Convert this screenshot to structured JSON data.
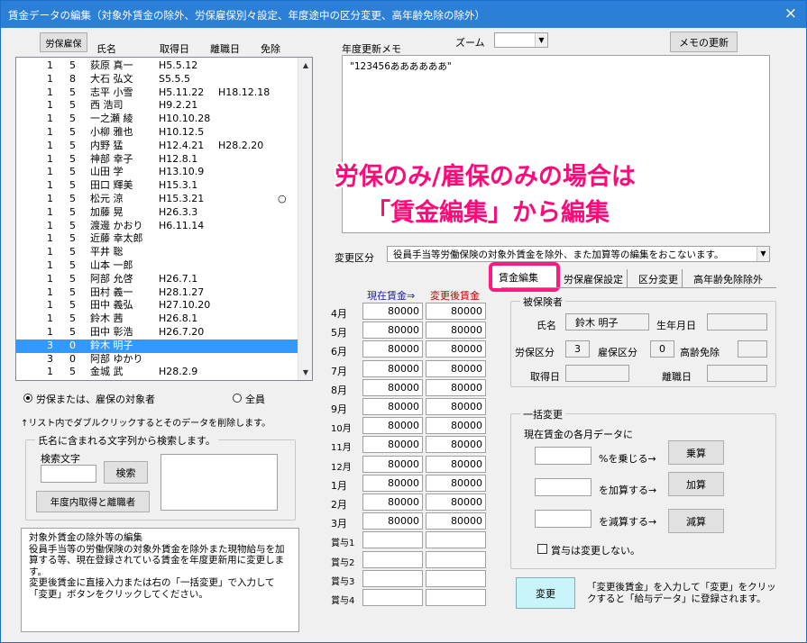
{
  "window": {
    "title": "賃金データの編集（対象外賃金の除外、労保雇保別々設定、年度途中の区分変更、高年齢免除の除外）",
    "close": "×"
  },
  "left": {
    "rousai_button": "労保雇保",
    "headers": {
      "name": "氏名",
      "acquired": "取得日",
      "left": "離職日",
      "exempt": "免除"
    },
    "rows": [
      {
        "a": "1",
        "b": "5",
        "name": "荻原 真一",
        "acq": "H5.5.12",
        "lef": "",
        "ex": ""
      },
      {
        "a": "1",
        "b": "8",
        "name": "大石 弘文",
        "acq": "S5.5.5",
        "lef": "",
        "ex": ""
      },
      {
        "a": "1",
        "b": "5",
        "name": "志平 小雪",
        "acq": "H5.11.22",
        "lef": "H18.12.18",
        "ex": ""
      },
      {
        "a": "1",
        "b": "5",
        "name": "西 浩司",
        "acq": "H9.2.21",
        "lef": "",
        "ex": ""
      },
      {
        "a": "1",
        "b": "5",
        "name": "一之瀬 綾",
        "acq": "H10.10.28",
        "lef": "",
        "ex": ""
      },
      {
        "a": "1",
        "b": "5",
        "name": "小柳 雅也",
        "acq": "H10.12.5",
        "lef": "",
        "ex": ""
      },
      {
        "a": "1",
        "b": "5",
        "name": "内野 猛",
        "acq": "H12.4.21",
        "lef": "H28.2.20",
        "ex": ""
      },
      {
        "a": "1",
        "b": "5",
        "name": "神部 幸子",
        "acq": "H12.8.1",
        "lef": "",
        "ex": ""
      },
      {
        "a": "1",
        "b": "5",
        "name": "山田 学",
        "acq": "H13.10.9",
        "lef": "",
        "ex": ""
      },
      {
        "a": "1",
        "b": "5",
        "name": "田口 輝美",
        "acq": "H15.3.1",
        "lef": "",
        "ex": ""
      },
      {
        "a": "1",
        "b": "5",
        "name": "松元 涼",
        "acq": "H15.3.21",
        "lef": "",
        "ex": "○"
      },
      {
        "a": "1",
        "b": "5",
        "name": "加藤 晃",
        "acq": "H26.3.3",
        "lef": "",
        "ex": ""
      },
      {
        "a": "1",
        "b": "5",
        "name": "渡邊 かおり",
        "acq": "H6.11.14",
        "lef": "",
        "ex": ""
      },
      {
        "a": "1",
        "b": "5",
        "name": "近藤 幸太郎",
        "acq": "",
        "lef": "",
        "ex": ""
      },
      {
        "a": "1",
        "b": "5",
        "name": "平井 聡",
        "acq": "",
        "lef": "",
        "ex": ""
      },
      {
        "a": "1",
        "b": "5",
        "name": "山本 一郎",
        "acq": "",
        "lef": "",
        "ex": ""
      },
      {
        "a": "1",
        "b": "5",
        "name": "阿部 允啓",
        "acq": "H26.7.1",
        "lef": "",
        "ex": ""
      },
      {
        "a": "1",
        "b": "5",
        "name": "田村 義一",
        "acq": "H28.1.27",
        "lef": "",
        "ex": ""
      },
      {
        "a": "1",
        "b": "5",
        "name": "田中 義弘",
        "acq": "H27.10.20",
        "lef": "",
        "ex": ""
      },
      {
        "a": "1",
        "b": "5",
        "name": "鈴木 茜",
        "acq": "H26.8.1",
        "lef": "",
        "ex": ""
      },
      {
        "a": "1",
        "b": "5",
        "name": "田中 彰浩",
        "acq": "H26.7.20",
        "lef": "",
        "ex": ""
      },
      {
        "a": "3",
        "b": "0",
        "name": "鈴木 明子",
        "acq": "",
        "lef": "",
        "ex": ""
      },
      {
        "a": "3",
        "b": "0",
        "name": "阿部 ゆかり",
        "acq": "",
        "lef": "",
        "ex": ""
      },
      {
        "a": "1",
        "b": "5",
        "name": "金城 武",
        "acq": "H28.2.9",
        "lef": "",
        "ex": ""
      }
    ],
    "selected_index": 21,
    "radio_target": "労保または、雇保の対象者",
    "radio_all": "全員",
    "hint": "↑リスト内でダブルクリックするとそのデータを削除します。",
    "search_group": "氏名に含まれる文字列から検索します。",
    "search_label": "検索文字",
    "search_value": "",
    "search_button": "検索",
    "year_button": "年度内取得と離職者",
    "description": "対象外賃金の除外等の編集\n役員手当等の労働保険の対象外賃金を除外また現物給与を加算する等、現在登録されている賃金を年度更新用に変更します。\n変更後賃金に直接入力または右の「一括変更」で入力して「変更」ボタンをクリックしてください。"
  },
  "right": {
    "memo_label": "年度更新メモ",
    "zoom_label": "ズーム",
    "zoom_value": "",
    "memo_update_button": "メモの更新",
    "memo_text": "\"123456ああああああ\"",
    "overlay_line1": "労保のみ/雇保のみの場合は",
    "overlay_line2": "「賃金編集」から編集",
    "change_kind_label": "変更区分",
    "change_kind_value": "役員手当等労働保険の対象外賃金を除外、また加算等の編集をおこないます。",
    "tabs": [
      "賃金編集",
      "労保雇保設定",
      "区分変更",
      "高年齢免除除外"
    ],
    "col_current": "現在賃金⇒",
    "col_changed": "変更後賃金",
    "months": [
      {
        "m": "4月",
        "cur": "80000",
        "chg": "80000"
      },
      {
        "m": "5月",
        "cur": "80000",
        "chg": "80000"
      },
      {
        "m": "6月",
        "cur": "80000",
        "chg": "80000"
      },
      {
        "m": "7月",
        "cur": "80000",
        "chg": "80000"
      },
      {
        "m": "8月",
        "cur": "80000",
        "chg": "80000"
      },
      {
        "m": "9月",
        "cur": "80000",
        "chg": "80000"
      },
      {
        "m": "10月",
        "cur": "80000",
        "chg": "80000"
      },
      {
        "m": "11月",
        "cur": "80000",
        "chg": "80000"
      },
      {
        "m": "12月",
        "cur": "80000",
        "chg": "80000"
      },
      {
        "m": "1月",
        "cur": "80000",
        "chg": "80000"
      },
      {
        "m": "2月",
        "cur": "80000",
        "chg": "80000"
      },
      {
        "m": "3月",
        "cur": "80000",
        "chg": "80000"
      },
      {
        "m": "賞与1",
        "cur": "",
        "chg": ""
      },
      {
        "m": "賞与2",
        "cur": "",
        "chg": ""
      },
      {
        "m": "賞与3",
        "cur": "",
        "chg": ""
      },
      {
        "m": "賞与4",
        "cur": "",
        "chg": ""
      }
    ],
    "insured_group": "被保険者",
    "name_label": "氏名",
    "name_value": "鈴木 明子",
    "birth_label": "生年月日",
    "rouho_label": "労保区分",
    "rouho_value": "3",
    "koho_label": "雇保区分",
    "koho_value": "0",
    "elder_label": "高齢免除",
    "acq_label": "取得日",
    "left_label": "離職日",
    "bulk_group": "一括変更",
    "bulk_desc": "現在賃金の各月データに",
    "mul_label": "%を乗じる→",
    "mul_button": "乗算",
    "add_label": "を加算する→",
    "add_button": "加算",
    "sub_label": "を減算する→",
    "sub_button": "減算",
    "bonus_check": "賞与は変更しない。",
    "change_button": "変更",
    "change_note": "「変更後賃金」を入力して「変更」をクリックすると「給与データ」に登録されます。"
  },
  "colors": {
    "title": "#2b7fd6",
    "selection": "#3399ff",
    "overlay": "#ff0a78",
    "current_header": "#1a1aa0",
    "changed_header": "#c00000",
    "change_button": "#c8f5fa"
  }
}
